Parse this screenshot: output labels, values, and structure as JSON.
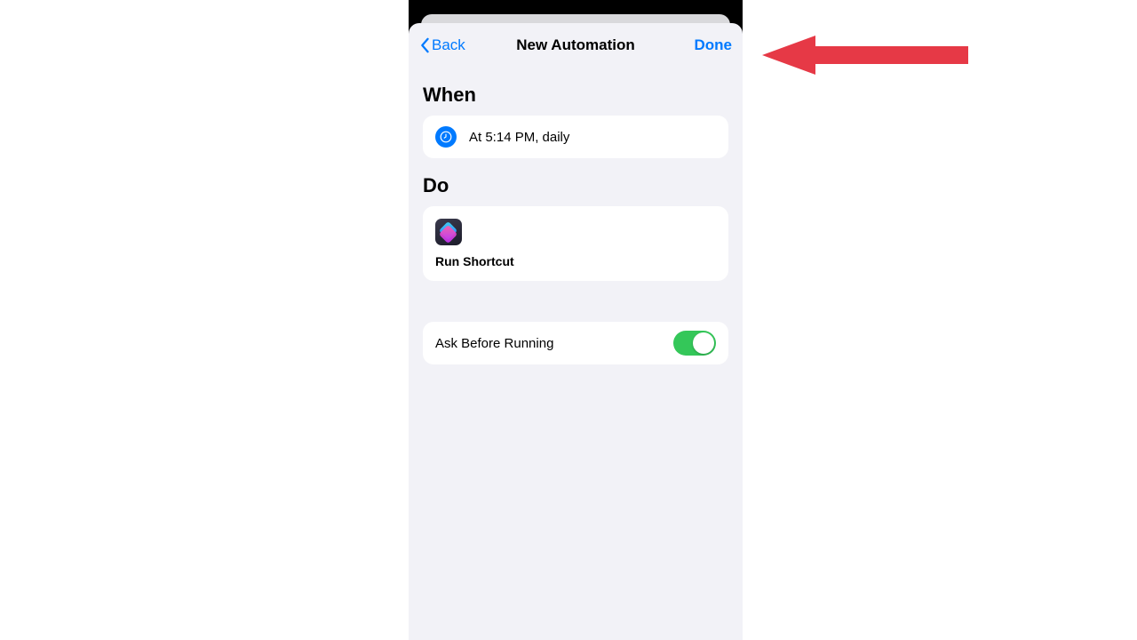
{
  "nav": {
    "back": "Back",
    "title": "New Automation",
    "done": "Done"
  },
  "sections": {
    "when_title": "When",
    "when_text": "At 5:14 PM, daily",
    "do_title": "Do",
    "do_text": "Run Shortcut"
  },
  "settings": {
    "ask_label": "Ask Before Running",
    "ask_value": true
  },
  "colors": {
    "ios_blue": "#007aff",
    "ios_green": "#34c759",
    "bg_gray": "#f2f2f7",
    "annotation_red": "#e63946"
  }
}
